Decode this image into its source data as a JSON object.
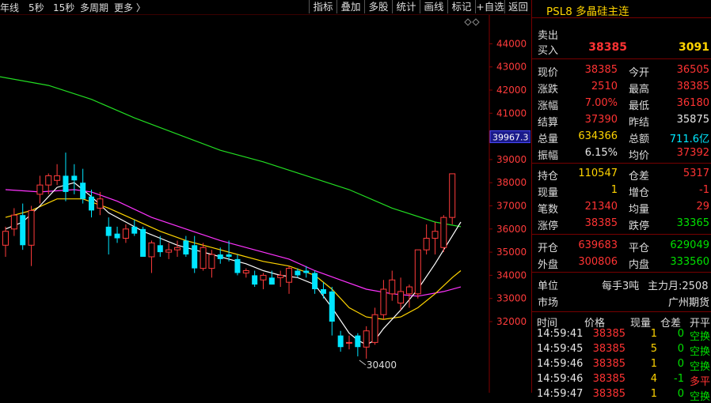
{
  "toolbar": {
    "periods": [
      "年线",
      "5秒",
      "15秒",
      "多周期",
      "更多 〉"
    ],
    "tools": [
      "指标",
      "叠加",
      "多股",
      "统计",
      "画线",
      "标记",
      "+自选",
      "返回"
    ]
  },
  "chart": {
    "y_ticks": [
      "44000",
      "43000",
      "42000",
      "41000",
      "40000",
      "39000",
      "38000",
      "37000",
      "36000",
      "35000",
      "34000",
      "33000",
      "32000"
    ],
    "current_price_tag": "39967.3",
    "low_annotation": "30400",
    "colors": {
      "up": "#ff3b3b",
      "down": "#00e5ff",
      "ma5": "#ffffff",
      "ma10": "#ffd400",
      "ma20": "#ff33ff",
      "ma60": "#22dd22"
    },
    "candles": [
      {
        "o": 35300,
        "h": 36100,
        "l": 34800,
        "c": 35900
      },
      {
        "o": 36000,
        "h": 36900,
        "l": 35700,
        "c": 36600
      },
      {
        "o": 36600,
        "h": 37100,
        "l": 35100,
        "c": 35300
      },
      {
        "o": 35300,
        "h": 37000,
        "l": 34400,
        "c": 36800
      },
      {
        "o": 37500,
        "h": 38300,
        "l": 37100,
        "c": 37900
      },
      {
        "o": 37900,
        "h": 38400,
        "l": 37500,
        "c": 38300
      },
      {
        "o": 38100,
        "h": 38800,
        "l": 37900,
        "c": 38300
      },
      {
        "o": 38300,
        "h": 39300,
        "l": 37200,
        "c": 37600
      },
      {
        "o": 38300,
        "h": 38800,
        "l": 37500,
        "c": 38100
      },
      {
        "o": 38000,
        "h": 38600,
        "l": 37100,
        "c": 37300
      },
      {
        "o": 37400,
        "h": 37700,
        "l": 36500,
        "c": 36800
      },
      {
        "o": 36900,
        "h": 37600,
        "l": 36600,
        "c": 37300
      },
      {
        "o": 36100,
        "h": 36500,
        "l": 34900,
        "c": 35700
      },
      {
        "o": 35800,
        "h": 36100,
        "l": 35400,
        "c": 35600
      },
      {
        "o": 35600,
        "h": 36200,
        "l": 35400,
        "c": 36000
      },
      {
        "o": 36100,
        "h": 36400,
        "l": 35700,
        "c": 35800
      },
      {
        "o": 36000,
        "h": 36100,
        "l": 34800,
        "c": 34800
      },
      {
        "o": 34800,
        "h": 35500,
        "l": 34100,
        "c": 35400
      },
      {
        "o": 35300,
        "h": 35700,
        "l": 34800,
        "c": 35000
      },
      {
        "o": 35000,
        "h": 35400,
        "l": 34700,
        "c": 35100
      },
      {
        "o": 35100,
        "h": 35500,
        "l": 34800,
        "c": 35200
      },
      {
        "o": 35500,
        "h": 35700,
        "l": 34800,
        "c": 34900
      },
      {
        "o": 35300,
        "h": 35700,
        "l": 34100,
        "c": 34300
      },
      {
        "o": 34300,
        "h": 35400,
        "l": 34200,
        "c": 35200
      },
      {
        "o": 34300,
        "h": 35100,
        "l": 33900,
        "c": 34900
      },
      {
        "o": 34900,
        "h": 35200,
        "l": 34500,
        "c": 34700
      },
      {
        "o": 34900,
        "h": 35500,
        "l": 34600,
        "c": 34800
      },
      {
        "o": 34700,
        "h": 34900,
        "l": 34000,
        "c": 34100
      },
      {
        "o": 34100,
        "h": 34300,
        "l": 33900,
        "c": 34200
      },
      {
        "o": 34000,
        "h": 34200,
        "l": 33500,
        "c": 33600
      },
      {
        "o": 33800,
        "h": 34100,
        "l": 33400,
        "c": 34000
      },
      {
        "o": 33900,
        "h": 34200,
        "l": 33600,
        "c": 33600
      },
      {
        "o": 33900,
        "h": 34200,
        "l": 33500,
        "c": 34000
      },
      {
        "o": 33700,
        "h": 34400,
        "l": 33200,
        "c": 34300
      },
      {
        "o": 34200,
        "h": 34300,
        "l": 33900,
        "c": 34000
      },
      {
        "o": 34200,
        "h": 34400,
        "l": 33900,
        "c": 34100
      },
      {
        "o": 34100,
        "h": 34200,
        "l": 33200,
        "c": 33400
      },
      {
        "o": 33400,
        "h": 33700,
        "l": 33000,
        "c": 33200
      },
      {
        "o": 33300,
        "h": 33500,
        "l": 31400,
        "c": 32000
      },
      {
        "o": 31400,
        "h": 31600,
        "l": 30700,
        "c": 30900
      },
      {
        "o": 31100,
        "h": 31400,
        "l": 30800,
        "c": 31100
      },
      {
        "o": 31400,
        "h": 31500,
        "l": 30500,
        "c": 30900
      },
      {
        "o": 30900,
        "h": 31800,
        "l": 30400,
        "c": 31600
      },
      {
        "o": 31100,
        "h": 32600,
        "l": 31000,
        "c": 32300
      },
      {
        "o": 32300,
        "h": 33800,
        "l": 32100,
        "c": 33400
      },
      {
        "o": 33200,
        "h": 34200,
        "l": 32900,
        "c": 33800
      },
      {
        "o": 32800,
        "h": 33900,
        "l": 32500,
        "c": 33300
      },
      {
        "o": 33200,
        "h": 33600,
        "l": 32600,
        "c": 33500
      },
      {
        "o": 33200,
        "h": 35100,
        "l": 33000,
        "c": 35100
      },
      {
        "o": 35100,
        "h": 36200,
        "l": 34900,
        "c": 35600
      },
      {
        "o": 35600,
        "h": 36300,
        "l": 34900,
        "c": 35900
      },
      {
        "o": 35200,
        "h": 36600,
        "l": 35000,
        "c": 36500
      },
      {
        "o": 36500,
        "h": 38400,
        "l": 36200,
        "c": 38385
      }
    ],
    "ma5": [
      [
        0,
        36000
      ],
      [
        2,
        36300
      ],
      [
        4,
        37000
      ],
      [
        6,
        37800
      ],
      [
        8,
        38000
      ],
      [
        10,
        37400
      ],
      [
        12,
        36700
      ],
      [
        14,
        36300
      ],
      [
        16,
        35900
      ],
      [
        18,
        35600
      ],
      [
        20,
        35300
      ],
      [
        22,
        35100
      ],
      [
        24,
        34900
      ],
      [
        26,
        34700
      ],
      [
        28,
        34500
      ],
      [
        30,
        34200
      ],
      [
        32,
        34000
      ],
      [
        34,
        33900
      ],
      [
        36,
        33600
      ],
      [
        38,
        32600
      ],
      [
        40,
        31500
      ],
      [
        41,
        31200
      ],
      [
        42,
        31000
      ],
      [
        43,
        31200
      ],
      [
        44,
        31700
      ],
      [
        46,
        32500
      ],
      [
        48,
        33400
      ],
      [
        50,
        34500
      ],
      [
        52,
        35700
      ],
      [
        53,
        36300
      ]
    ],
    "ma10": [
      [
        0,
        36500
      ],
      [
        3,
        36800
      ],
      [
        6,
        37300
      ],
      [
        9,
        37300
      ],
      [
        12,
        36900
      ],
      [
        15,
        36400
      ],
      [
        18,
        35900
      ],
      [
        21,
        35500
      ],
      [
        24,
        35200
      ],
      [
        27,
        34900
      ],
      [
        30,
        34600
      ],
      [
        33,
        34400
      ],
      [
        36,
        34000
      ],
      [
        38,
        33400
      ],
      [
        40,
        32600
      ],
      [
        42,
        32200
      ],
      [
        44,
        32100
      ],
      [
        46,
        32200
      ],
      [
        48,
        32600
      ],
      [
        50,
        33200
      ],
      [
        52,
        33900
      ],
      [
        53,
        34200
      ]
    ],
    "ma20": [
      [
        0,
        37700
      ],
      [
        4,
        37600
      ],
      [
        8,
        37700
      ],
      [
        10,
        37600
      ],
      [
        13,
        37200
      ],
      [
        17,
        36500
      ],
      [
        21,
        36000
      ],
      [
        25,
        35500
      ],
      [
        29,
        35100
      ],
      [
        33,
        34700
      ],
      [
        36,
        34200
      ],
      [
        39,
        33800
      ],
      [
        42,
        33400
      ],
      [
        45,
        33200
      ],
      [
        48,
        33100
      ],
      [
        51,
        33300
      ],
      [
        53,
        33500
      ]
    ],
    "ma60": [
      [
        -1,
        42600
      ],
      [
        5,
        42200
      ],
      [
        10,
        41600
      ],
      [
        15,
        40800
      ],
      [
        20,
        40100
      ],
      [
        25,
        39400
      ],
      [
        30,
        38900
      ],
      [
        35,
        38300
      ],
      [
        40,
        37700
      ],
      [
        45,
        36900
      ],
      [
        50,
        36300
      ],
      [
        53,
        36100
      ]
    ]
  },
  "quote": {
    "title": "PSL8 多晶硅主连",
    "sell_label": "卖出",
    "buy_label": "买入",
    "buy_price": "38385",
    "buy_volume": "3091",
    "rows": [
      {
        "l1": "现价",
        "v1": "38385",
        "c1": "red",
        "l2": "今开",
        "v2": "36505",
        "c2": "red"
      },
      {
        "l1": "涨跌",
        "v1": "2510",
        "c1": "red",
        "l2": "最高",
        "v2": "38385",
        "c2": "red"
      },
      {
        "l1": "涨幅",
        "v1": "7.00%",
        "c1": "red",
        "l2": "最低",
        "v2": "36180",
        "c2": "red"
      },
      {
        "l1": "结算",
        "v1": "37390",
        "c1": "red",
        "l2": "昨结",
        "v2": "35875",
        "c2": "white"
      },
      {
        "l1": "总量",
        "v1": "634366",
        "c1": "yellow",
        "l2": "总额",
        "v2": "711.6亿",
        "c2": "cyan"
      },
      {
        "l1": "振幅",
        "v1": "6.15%",
        "c1": "white",
        "l2": "均价",
        "v2": "37392",
        "c2": "red"
      }
    ],
    "rows2": [
      {
        "l1": "持仓",
        "v1": "110547",
        "c1": "yellow",
        "l2": "仓差",
        "v2": "5317",
        "c2": "red"
      },
      {
        "l1": "现量",
        "v1": "1",
        "c1": "yellow",
        "l2": "增仓",
        "v2": "-1",
        "c2": "red"
      },
      {
        "l1": "笔数",
        "v1": "21340",
        "c1": "red",
        "l2": "均量",
        "v2": "29",
        "c2": "red"
      },
      {
        "l1": "涨停",
        "v1": "38385",
        "c1": "red",
        "l2": "跌停",
        "v2": "33365",
        "c2": "green"
      }
    ],
    "rows3": [
      {
        "l1": "开仓",
        "v1": "639683",
        "c1": "red",
        "l2": "平仓",
        "v2": "629049",
        "c2": "green"
      },
      {
        "l1": "外盘",
        "v1": "300806",
        "c1": "red",
        "l2": "内盘",
        "v2": "333560",
        "c2": "green"
      }
    ],
    "unit_label": "单位",
    "unit_value": "每手3吨",
    "main_month": "主力月:2508",
    "market_label": "市场",
    "market_value": "广州期货",
    "ticks_header": [
      "时间",
      "价格",
      "现量",
      "仓差",
      "开平"
    ],
    "ticks": [
      {
        "t": "14:59:41",
        "p": "38385",
        "q": "1",
        "d": "0",
        "k": "空换",
        "kc": "green"
      },
      {
        "t": "14:59:45",
        "p": "38385",
        "q": "5",
        "d": "0",
        "k": "空换",
        "kc": "green"
      },
      {
        "t": "14:59:46",
        "p": "38385",
        "q": "1",
        "d": "0",
        "k": "空换",
        "kc": "green"
      },
      {
        "t": "14:59:46",
        "p": "38385",
        "q": "4",
        "d": "-1",
        "k": "多平",
        "kc": "red"
      },
      {
        "t": "14:59:47",
        "p": "38385",
        "q": "1",
        "d": "0",
        "k": "空换",
        "kc": "green"
      }
    ]
  }
}
